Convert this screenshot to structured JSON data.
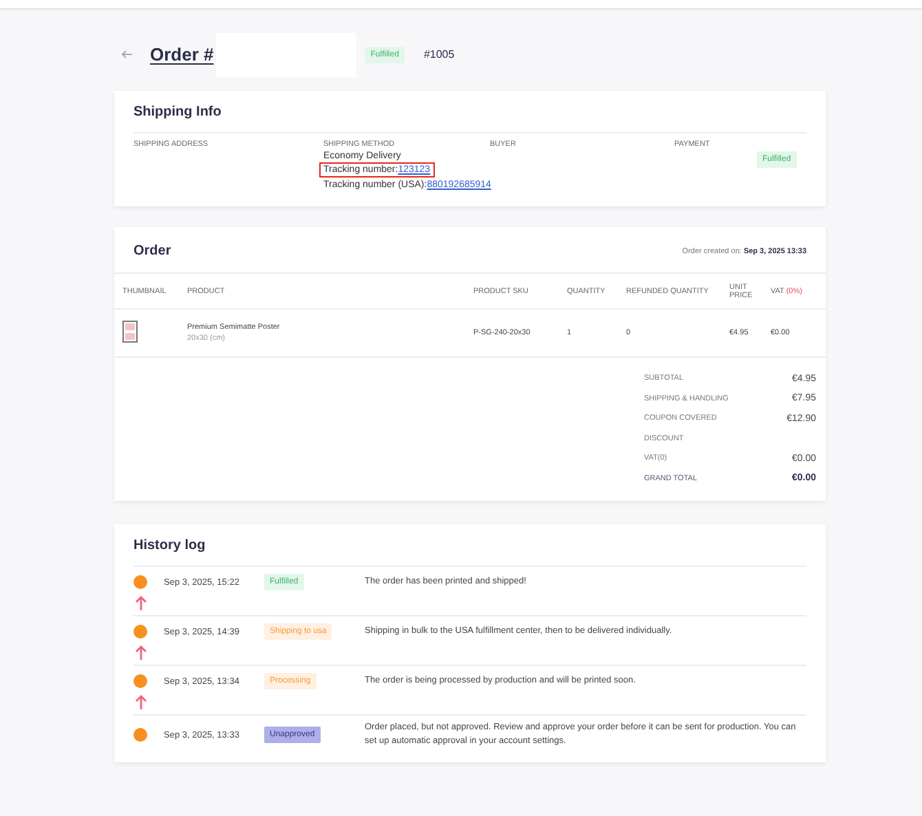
{
  "header": {
    "title": "Order #",
    "status": {
      "label": "Fulfilled",
      "kind": "fulfilled"
    },
    "order_number": "#1005"
  },
  "shipping": {
    "title": "Shipping Info",
    "columns": [
      {
        "label": "SHIPPING ADDRESS"
      },
      {
        "label": "SHIPPING METHOD",
        "value": "Economy Delivery",
        "tracking": [
          {
            "label": "Tracking number:",
            "number": "123123",
            "highlighted": true
          },
          {
            "label": "Tracking number (USA):",
            "number": "880192685914",
            "highlighted": false
          }
        ]
      },
      {
        "label": "BUYER"
      },
      {
        "label": "PAYMENT"
      }
    ],
    "payment_status": {
      "label": "Fulfilled",
      "kind": "fulfilled"
    }
  },
  "order": {
    "title": "Order",
    "created_label": "Order created on:",
    "created_value": "Sep 3, 2025 13:33",
    "columns": [
      "THUMBNAIL",
      "PRODUCT",
      "PRODUCT SKU",
      "QUANTITY",
      "REFUNDED QUANTITY",
      "UNIT PRICE"
    ],
    "vat_column": {
      "label": "VAT",
      "rate": "(0%)"
    },
    "rows": [
      {
        "product": "Premium Semimatte Poster",
        "size": "20x30 (cm)",
        "sku": "P-SG-240-20x30",
        "quantity": "1",
        "refunded": "0",
        "unit_price": "€4.95",
        "vat": "€0.00"
      }
    ],
    "totals": [
      {
        "label": "SUBTOTAL",
        "value": "€4.95",
        "bold": false
      },
      {
        "label": "SHIPPING & HANDLING",
        "value": "€7.95",
        "bold": false
      },
      {
        "label": "COUPON COVERED",
        "value": "€12.90",
        "bold": false
      },
      {
        "label": "DISCOUNT",
        "bold": false
      },
      {
        "label": "VAT(0)",
        "value": "€0.00",
        "bold": false
      },
      {
        "label": "GRAND TOTAL",
        "value": "€0.00",
        "bold": true
      }
    ]
  },
  "history": {
    "title": "History log",
    "entries": [
      {
        "date": "Sep 3, 2025, 15:22",
        "status": {
          "label": "Fulfilled",
          "kind": "fulfilled"
        },
        "message": "The order has been printed and shipped!"
      },
      {
        "date": "Sep 3, 2025, 14:39",
        "status": {
          "label": "Shipping to usa",
          "kind": "pending"
        },
        "message": "Shipping in bulk to the USA fulfillment center, then to be delivered individually."
      },
      {
        "date": "Sep 3, 2025, 13:34",
        "status": {
          "label": "Processing",
          "kind": "pending"
        },
        "message": "The order is being processed by production and will be printed soon."
      },
      {
        "date": "Sep 3, 2025, 13:33",
        "status": {
          "label": "Unapproved",
          "kind": "unapproved"
        },
        "message": "Order placed, but not approved. Review and approve your order before it can be sent for production. You can set up automatic approval in your account settings."
      }
    ]
  }
}
